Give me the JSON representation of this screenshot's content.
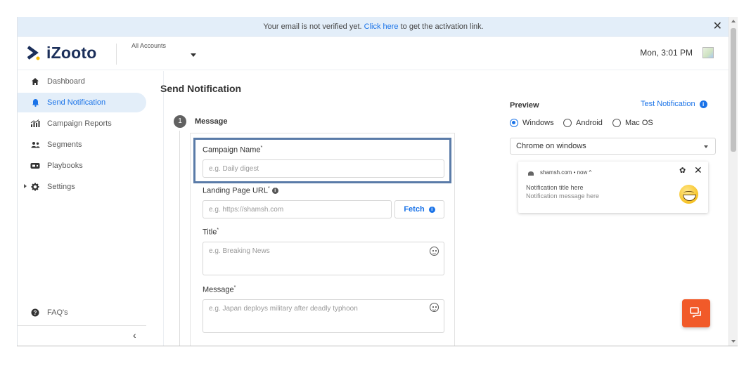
{
  "banner": {
    "text_before": "Your email is not verified yet.",
    "link": "Click here",
    "text_after": "to get the activation link.",
    "close": "✕"
  },
  "header": {
    "brand": "iZooto",
    "accounts_label": "All Accounts",
    "datetime": "Mon, 3:01 PM"
  },
  "sidebar": {
    "items": [
      {
        "label": "Dashboard",
        "icon": "home-icon"
      },
      {
        "label": "Send Notification",
        "icon": "bell-icon"
      },
      {
        "label": "Campaign Reports",
        "icon": "bar-chart-icon"
      },
      {
        "label": "Segments",
        "icon": "users-icon"
      },
      {
        "label": "Playbooks",
        "icon": "playbook-icon"
      },
      {
        "label": "Settings",
        "icon": "gear-icon"
      }
    ],
    "faq": "FAQ's",
    "collapse": "‹"
  },
  "main": {
    "title": "Send Notification",
    "step_number": "1",
    "step_label": "Message",
    "fields": {
      "campaign_name": {
        "label": "Campaign Name",
        "placeholder": "e.g. Daily digest"
      },
      "landing_url": {
        "label": "Landing Page URL",
        "placeholder": "e.g. https://shamsh.com"
      },
      "fetch_label": "Fetch",
      "title": {
        "label": "Title",
        "placeholder": "e.g. Breaking News"
      },
      "message": {
        "label": "Message",
        "placeholder": "e.g. Japan deploys military after deadly typhoon"
      }
    },
    "required_mark": "*",
    "info_glyph": "i"
  },
  "preview": {
    "label": "Preview",
    "test_notification": "Test Notification",
    "platforms": [
      {
        "label": "Windows",
        "selected": true
      },
      {
        "label": "Android",
        "selected": false
      },
      {
        "label": "Mac OS",
        "selected": false
      }
    ],
    "browser_select": "Chrome on windows",
    "notification": {
      "source": "shamsh.com • now ^",
      "title": "Notification title here",
      "message": "Notification message here"
    }
  },
  "colors": {
    "accent": "#1a73e8",
    "brand_navy": "#1b2f5a",
    "brand_yellow": "#f5b800",
    "chat": "#f15a29",
    "active_bg": "#e3eef9"
  }
}
